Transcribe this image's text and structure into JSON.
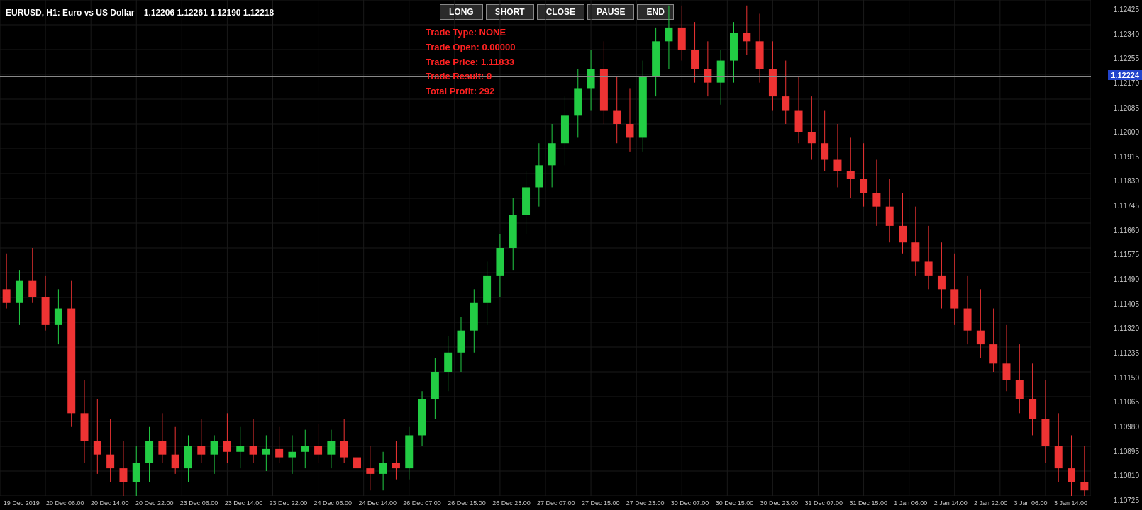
{
  "header": {
    "symbol": "EURUSD, H1: Euro vs US Dollar",
    "ohlc": "1.12206  1.12261  1.12190  1.12218"
  },
  "buttons": {
    "long": "LONG",
    "short": "SHORT",
    "close": "CLOSE",
    "pause": "PAUSE",
    "end": "END"
  },
  "trade_info": {
    "type_label": "Trade Type: NONE",
    "open_label": "Trade Open: 0.00000",
    "price_label": "Trade Price: 1.11833",
    "result_label": "Trade Result: 0",
    "profit_label": "Total Profit: 292"
  },
  "price_label": "1.12224",
  "y_axis": [
    "1.12425",
    "1.12340",
    "1.12255",
    "1.12170",
    "1.12085",
    "1.12000",
    "1.11915",
    "1.11830",
    "1.11745",
    "1.11660",
    "1.11575",
    "1.11490",
    "1.11405",
    "1.11320",
    "1.11235",
    "1.11150",
    "1.11065",
    "1.10980",
    "1.10895",
    "1.10810",
    "1.10725"
  ],
  "x_axis": [
    "19 Dec 2019",
    "20 Dec 06:00",
    "20 Dec 14:00",
    "20 Dec 22:00",
    "23 Dec 06:00",
    "23 Dec 14:00",
    "23 Dec 22:00",
    "24 Dec 06:00",
    "24 Dec 14:00",
    "26 Dec 07:00",
    "26 Dec 15:00",
    "26 Dec 23:00",
    "27 Dec 07:00",
    "27 Dec 15:00",
    "27 Dec 23:00",
    "30 Dec 07:00",
    "30 Dec 15:00",
    "30 Dec 23:00",
    "31 Dec 07:00",
    "31 Dec 15:00",
    "1 Jan 06:00",
    "2 Jan 14:00",
    "2 Jan 22:00",
    "3 Jan 06:00",
    "3 Jan 14:00"
  ],
  "colors": {
    "bull": "#22cc44",
    "bear": "#ee3333",
    "bg": "#000000",
    "text": "#ffffff",
    "grid": "#1a1a1a",
    "axis": "#cccccc"
  }
}
